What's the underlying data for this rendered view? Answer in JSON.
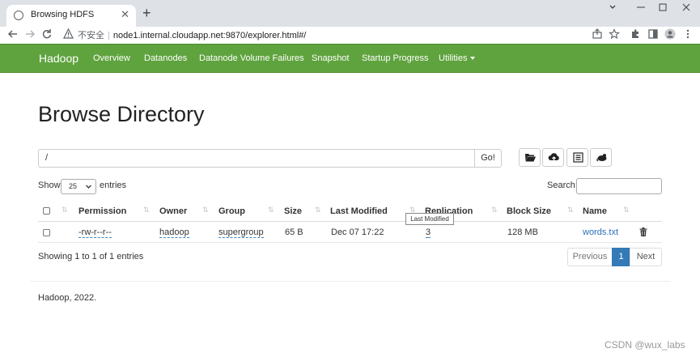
{
  "browser": {
    "tab_title": "Browsing HDFS",
    "security_label": "不安全",
    "url": "node1.internal.cloudapp.net:9870/explorer.html#/"
  },
  "navbar": {
    "brand": "Hadoop",
    "links": [
      "Overview",
      "Datanodes",
      "Datanode Volume Failures",
      "Snapshot",
      "Startup Progress",
      "Utilities"
    ],
    "color": "#5fa33e"
  },
  "page": {
    "title": "Browse Directory",
    "path_value": "/",
    "go_label": "Go!",
    "show_label": "Show",
    "entries_select": "25",
    "entries_label": "entries",
    "search_label": "Search:"
  },
  "table": {
    "columns": [
      "Permission",
      "Owner",
      "Group",
      "Size",
      "Last Modified",
      "Replication",
      "Block Size",
      "Name"
    ],
    "rows": [
      {
        "permission": "-rw-r--r--",
        "owner": "hadoop",
        "group": "supergroup",
        "size": "65 B",
        "last_modified": "Dec 07 17:22",
        "replication": "3",
        "block_size": "128 MB",
        "name": "words.txt"
      }
    ],
    "tooltip": "Last Modified"
  },
  "pagination": {
    "info": "Showing 1 to 1 of 1 entries",
    "previous": "Previous",
    "current": "1",
    "next": "Next"
  },
  "footer": {
    "text": "Hadoop, 2022."
  },
  "watermark": "CSDN @wux_labs"
}
